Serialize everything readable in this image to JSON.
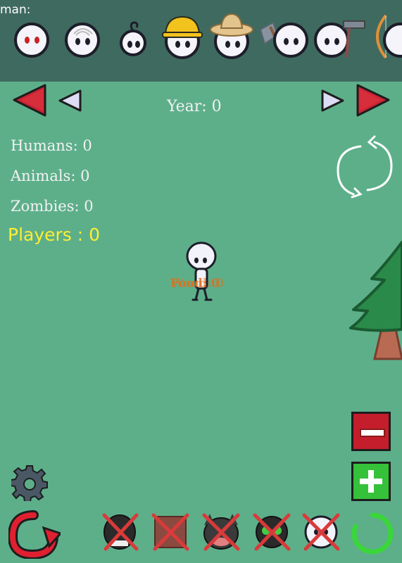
{
  "topbar": {
    "label": "man:",
    "characters": [
      {
        "name": "zombie-red-eyes"
      },
      {
        "name": "swirl-hair"
      },
      {
        "name": "small-curl"
      },
      {
        "name": "hard-hat-worker"
      },
      {
        "name": "straw-hat-farmer"
      },
      {
        "name": "axe-holder"
      },
      {
        "name": "plain"
      },
      {
        "name": "hammer-holder"
      },
      {
        "name": "archer"
      }
    ]
  },
  "hud": {
    "year_label": "Year: 0",
    "humans": "Humans: 0",
    "animals": "Animals: 0",
    "zombies": "Zombies: 0",
    "players": "Players : 0"
  },
  "world": {
    "overlap_label_a": "Food: 0",
    "overlap_label_b": "Wood: 0"
  },
  "icons": {
    "prev_fast": "double-left-arrow-icon",
    "prev": "left-arrow-icon",
    "next": "right-arrow-icon",
    "next_fast": "double-right-arrow-icon",
    "cycle": "cycle-arrows-icon",
    "settings": "gear-icon",
    "restart": "restart-icon",
    "zoom_out": "minus-button",
    "zoom_in": "plus-button",
    "loading": "loading-ring-icon"
  },
  "colors": {
    "background": "#5daf8a",
    "topbar": "#3f6a5f",
    "red_arrow": "#cc2233",
    "player_text": "#ffee33",
    "disabled_cross": "#d93a3a"
  }
}
